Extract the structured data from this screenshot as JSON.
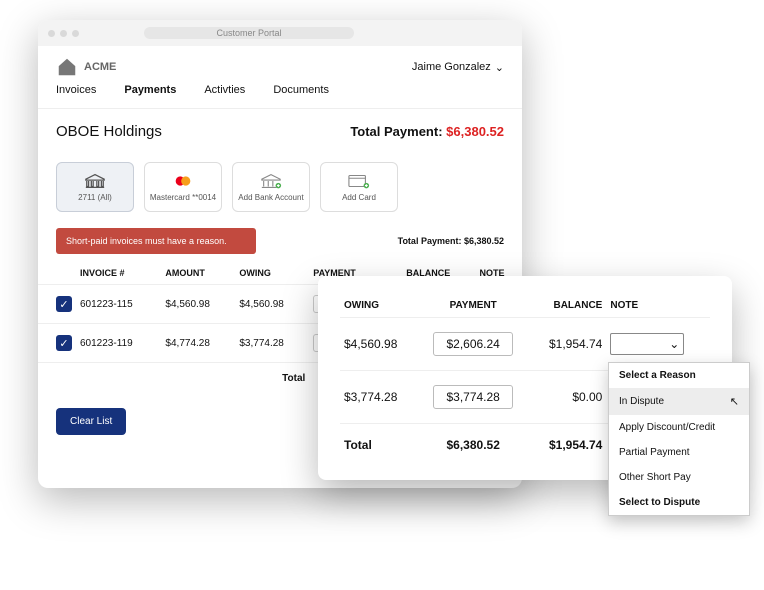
{
  "chrome": {
    "title": "Customer Portal"
  },
  "brand": "ACME",
  "user": {
    "name": "Jaime Gonzalez"
  },
  "tabs": [
    "Invoices",
    "Payments",
    "Activties",
    "Documents"
  ],
  "activeTab": 1,
  "customer": "OBOE Holdings",
  "totalPaymentLabel": "Total Payment:",
  "totalPaymentAmount": "$6,380.52",
  "paymentMethods": [
    {
      "label": "2711 (All)",
      "icon": "bank"
    },
    {
      "label": "Mastercard **0014",
      "icon": "mastercard"
    },
    {
      "label": "Add Bank Account",
      "icon": "bank-add"
    },
    {
      "label": "Add Card",
      "icon": "card-add"
    }
  ],
  "alert": "Short-paid invoices must have a reason.",
  "subTotal": "Total Payment: $6,380.52",
  "invHeaders": [
    "",
    "INVOICE #",
    "AMOUNT",
    "OWING",
    "PAYMENT",
    "BALANCE",
    "NOTE"
  ],
  "invoices": [
    {
      "num": "601223-115",
      "amount": "$4,560.98",
      "owing": "$4,560.98"
    },
    {
      "num": "601223-119",
      "amount": "$4,774.28",
      "owing": "$3,774.28"
    }
  ],
  "totalLabel": "Total",
  "clearList": "Clear List",
  "overlayHeaders": [
    "OWING",
    "PAYMENT",
    "BALANCE",
    "NOTE"
  ],
  "overlayRows": [
    {
      "owing": "$4,560.98",
      "payment": "$2,606.24",
      "balance": "$1,954.74",
      "hasNote": true
    },
    {
      "owing": "$3,774.28",
      "payment": "$3,774.28",
      "balance": "$0.00",
      "hasNote": false
    }
  ],
  "overlayTotal": {
    "label": "Total",
    "payment": "$6,380.52",
    "balance": "$1,954.74"
  },
  "dropdown": {
    "header": "Select a Reason",
    "options": [
      "In Dispute",
      "Apply Discount/Credit",
      "Partial Payment",
      "Other Short Pay"
    ],
    "footer": "Select to Dispute",
    "hoverIndex": 0
  }
}
